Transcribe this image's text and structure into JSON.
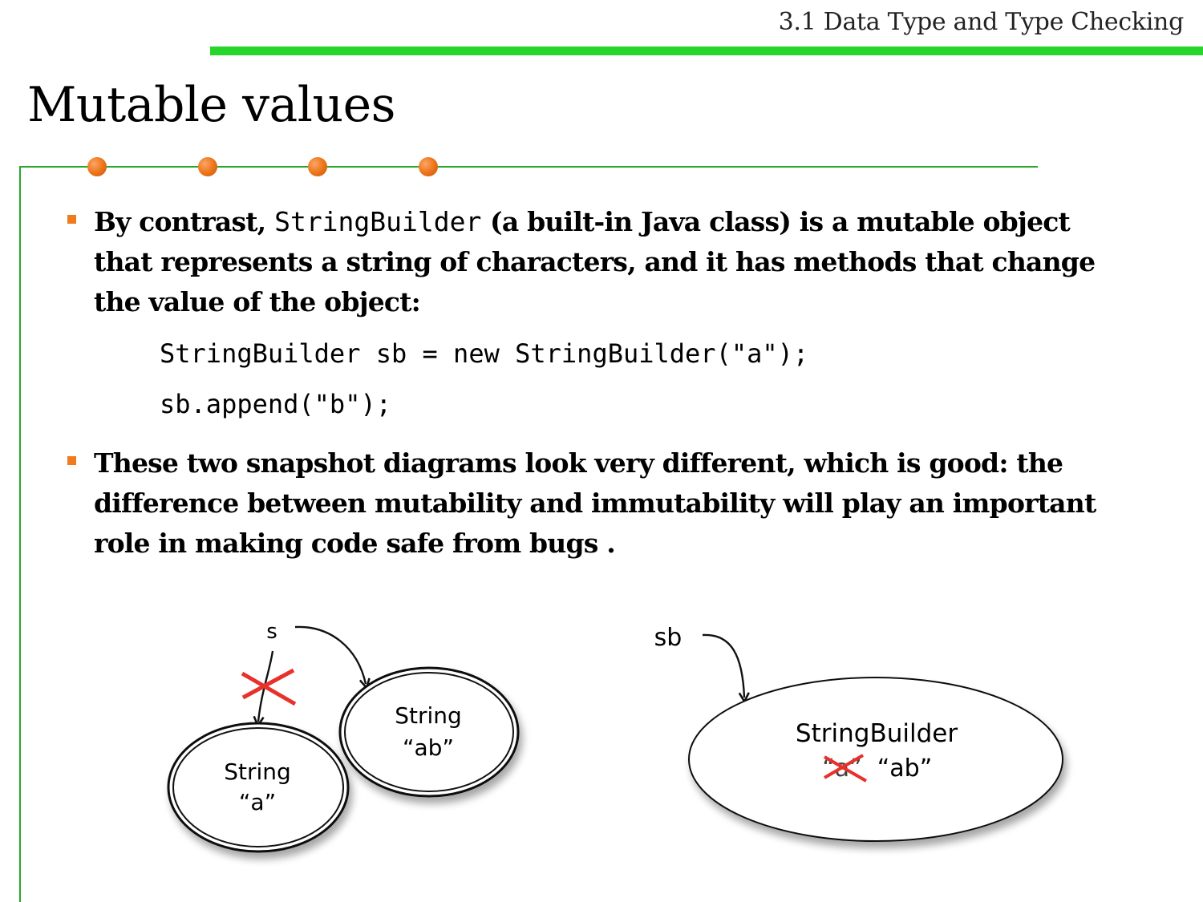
{
  "header": {
    "section_title": "3.1 Data Type and Type Checking"
  },
  "slide": {
    "title": "Mutable values"
  },
  "bullets": {
    "first": {
      "pre": "By contrast, ",
      "code": "StringBuilder",
      "post": " (a built-in Java class) is a mutable object that represents a string of characters, and it has methods that change the value of the object:"
    },
    "second": "These two snapshot diagrams look very different, which is good: the difference between mutability and immutability will play an important role in making code safe from bugs ."
  },
  "code_lines": [
    "StringBuilder sb = new StringBuilder(\"a\");",
    "sb.append(\"b\");"
  ],
  "diagram_left": {
    "variable": "s",
    "old_object": {
      "type": "String",
      "value": "“a”"
    },
    "new_object": {
      "type": "String",
      "value": "“ab”"
    }
  },
  "diagram_right": {
    "variable": "sb",
    "object_type": "StringBuilder",
    "old_value": "“a”",
    "new_value": "“ab”"
  },
  "colors": {
    "accent_green": "#27d62a",
    "frame_green": "#2aa52a",
    "bullet_orange": "#f07a1e",
    "cross_red": "#e8312a"
  }
}
